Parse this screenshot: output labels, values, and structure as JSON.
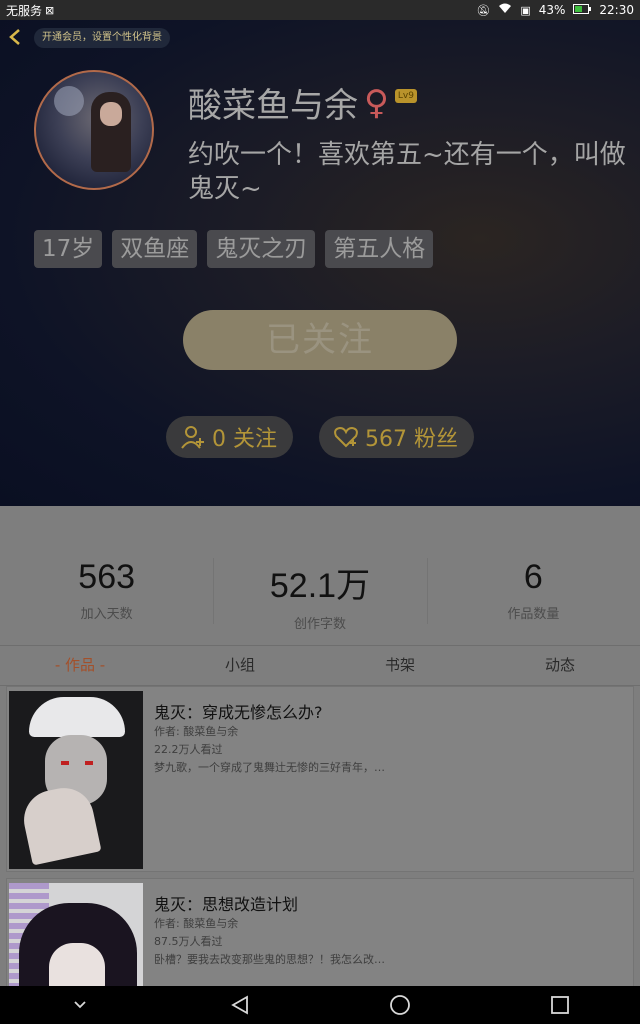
{
  "status_bar": {
    "carrier": "无服务",
    "battery": "43%",
    "time": "22:30"
  },
  "header": {
    "vip_banner": "开通会员，设置个性化背景",
    "nickname": "酸菜鱼与余",
    "level": "Lv9",
    "signature": "约吹一个！喜欢第五~还有一个，叫做鬼灭~",
    "tags": [
      "17岁",
      "双鱼座",
      "鬼灭之刃",
      "第五人格"
    ],
    "follow_button": "已关注",
    "following": "0 关注",
    "fans": "567 粉丝"
  },
  "stats": [
    {
      "value": "563",
      "label": "加入天数"
    },
    {
      "value": "52.1万",
      "label": "创作字数"
    },
    {
      "value": "6",
      "label": "作品数量"
    }
  ],
  "tabs": [
    "- 作品 -",
    "小组",
    "书架",
    "动态"
  ],
  "works": [
    {
      "title": "鬼灭：穿成无惨怎么办?",
      "author": "作者: 酸菜鱼与余",
      "views": "22.2万人看过",
      "excerpt": "梦九歌，一个穿成了鬼舞辻无惨的三好青年，…"
    },
    {
      "title": "鬼灭：思想改造计划",
      "author": "作者: 酸菜鱼与余",
      "views": "87.5万人看过",
      "excerpt": "卧槽？要我去改变那些鬼的思想？！我怎么改…"
    }
  ],
  "colors": {
    "accent_gold": "#b39538",
    "active_tab": "#a3502a",
    "gender": "#c85a5a"
  }
}
